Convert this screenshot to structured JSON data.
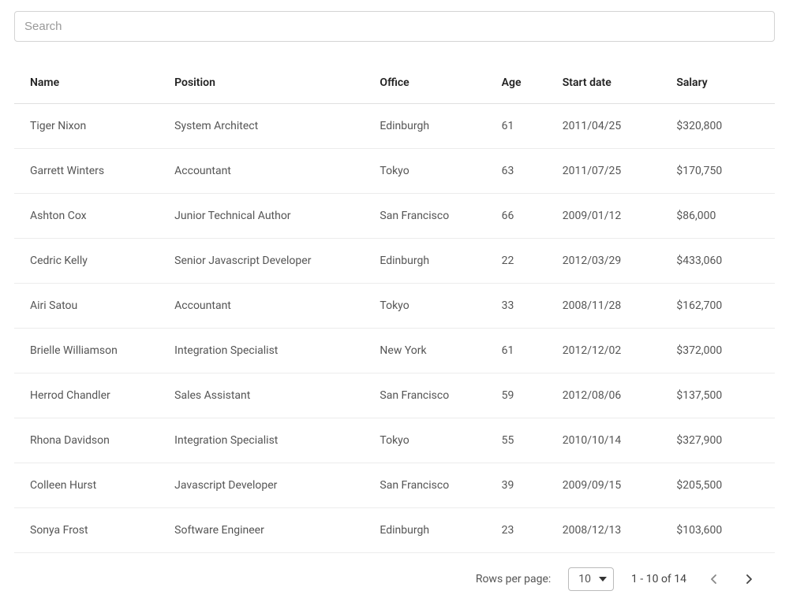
{
  "search": {
    "placeholder": "Search",
    "value": ""
  },
  "table": {
    "headers": {
      "name": "Name",
      "position": "Position",
      "office": "Office",
      "age": "Age",
      "start_date": "Start date",
      "salary": "Salary"
    },
    "rows": [
      {
        "name": "Tiger Nixon",
        "position": "System Architect",
        "office": "Edinburgh",
        "age": "61",
        "start_date": "2011/04/25",
        "salary": "$320,800"
      },
      {
        "name": "Garrett Winters",
        "position": "Accountant",
        "office": "Tokyo",
        "age": "63",
        "start_date": "2011/07/25",
        "salary": "$170,750"
      },
      {
        "name": "Ashton Cox",
        "position": "Junior Technical Author",
        "office": "San Francisco",
        "age": "66",
        "start_date": "2009/01/12",
        "salary": "$86,000"
      },
      {
        "name": "Cedric Kelly",
        "position": "Senior Javascript Developer",
        "office": "Edinburgh",
        "age": "22",
        "start_date": "2012/03/29",
        "salary": "$433,060"
      },
      {
        "name": "Airi Satou",
        "position": "Accountant",
        "office": "Tokyo",
        "age": "33",
        "start_date": "2008/11/28",
        "salary": "$162,700"
      },
      {
        "name": "Brielle Williamson",
        "position": "Integration Specialist",
        "office": "New York",
        "age": "61",
        "start_date": "2012/12/02",
        "salary": "$372,000"
      },
      {
        "name": "Herrod Chandler",
        "position": "Sales Assistant",
        "office": "San Francisco",
        "age": "59",
        "start_date": "2012/08/06",
        "salary": "$137,500"
      },
      {
        "name": "Rhona Davidson",
        "position": "Integration Specialist",
        "office": "Tokyo",
        "age": "55",
        "start_date": "2010/10/14",
        "salary": "$327,900"
      },
      {
        "name": "Colleen Hurst",
        "position": "Javascript Developer",
        "office": "San Francisco",
        "age": "39",
        "start_date": "2009/09/15",
        "salary": "$205,500"
      },
      {
        "name": "Sonya Frost",
        "position": "Software Engineer",
        "office": "Edinburgh",
        "age": "23",
        "start_date": "2008/12/13",
        "salary": "$103,600"
      }
    ]
  },
  "pagination": {
    "rows_per_page_label": "Rows per page:",
    "rows_per_page_value": "10",
    "range_text": "1 - 10 of 14"
  }
}
